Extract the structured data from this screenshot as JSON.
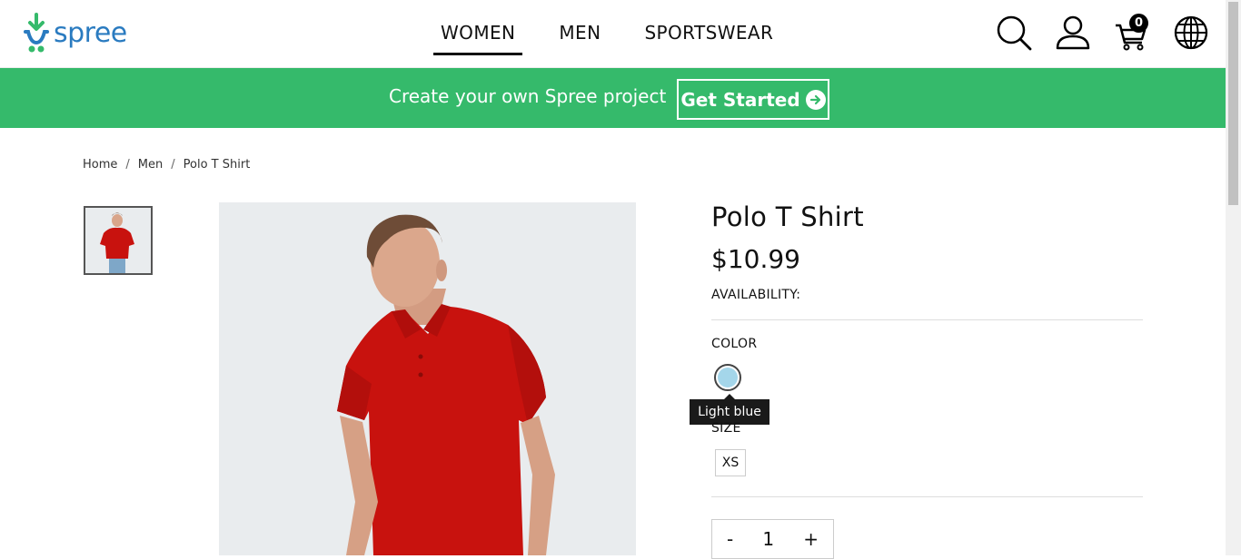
{
  "header": {
    "logo_text": "spree",
    "nav": [
      {
        "label": "WOMEN",
        "active": true
      },
      {
        "label": "MEN",
        "active": false
      },
      {
        "label": "SPORTSWEAR",
        "active": false
      }
    ],
    "icons": [
      "search-icon",
      "account-icon",
      "cart-icon",
      "globe-icon"
    ],
    "cart_count": "0"
  },
  "promo": {
    "text": "Create your own Spree project",
    "button_label": "Get Started",
    "color": "#35ba6b"
  },
  "breadcrumb": [
    "Home",
    "Men",
    "Polo T Shirt"
  ],
  "product": {
    "title": "Polo T Shirt",
    "price": "$10.99",
    "availability_label": "AVAILABILITY:",
    "color_label": "COLOR",
    "selected_color_name": "Light blue",
    "selected_color_hex": "#a4d6ea",
    "size_label": "SIZE",
    "sizes": [
      "XS"
    ],
    "quantity": {
      "minus": "-",
      "value": "1",
      "plus": "+"
    }
  }
}
